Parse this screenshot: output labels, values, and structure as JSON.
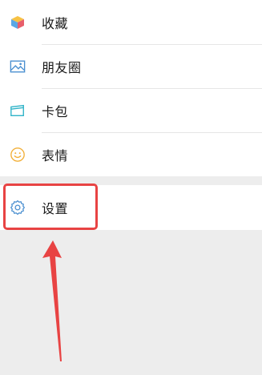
{
  "menu": {
    "items": [
      {
        "label": "收藏",
        "icon": "cube-icon"
      },
      {
        "label": "朋友圈",
        "icon": "image-icon"
      },
      {
        "label": "卡包",
        "icon": "card-icon"
      },
      {
        "label": "表情",
        "icon": "smile-icon"
      }
    ],
    "settings": {
      "label": "设置",
      "icon": "gear-icon"
    }
  },
  "annotation": {
    "color": "#e84343"
  }
}
